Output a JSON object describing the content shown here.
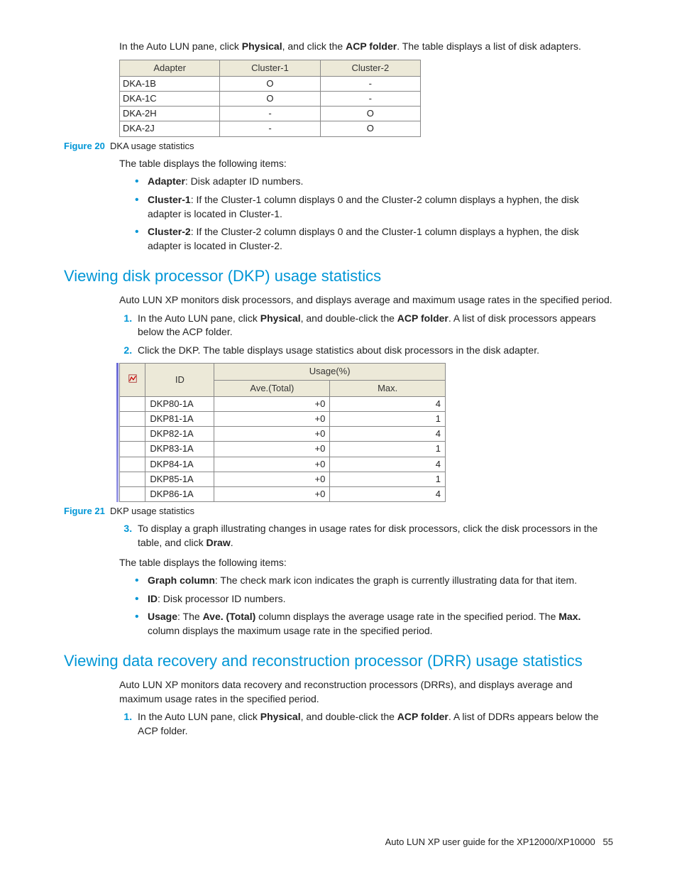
{
  "intro": {
    "p1a": "In the Auto LUN pane, click ",
    "p1b": "Physical",
    "p1c": ", and click the ",
    "p1d": "ACP folder",
    "p1e": ". The table displays a list of disk adapters."
  },
  "dka_table": {
    "headers": [
      "Adapter",
      "Cluster-1",
      "Cluster-2"
    ],
    "rows": [
      [
        "DKA-1B",
        "O",
        "-"
      ],
      [
        "DKA-1C",
        "O",
        "-"
      ],
      [
        "DKA-2H",
        "-",
        "O"
      ],
      [
        "DKA-2J",
        "-",
        "O"
      ]
    ]
  },
  "fig20": {
    "num": "Figure 20",
    "title": "DKA usage statistics"
  },
  "after_fig20": "The table displays the following items:",
  "bullets1": {
    "adapter_b": "Adapter",
    "adapter_t": ": Disk adapter ID numbers.",
    "c1_b": "Cluster-1",
    "c1_t": ": If the Cluster-1 column displays 0 and the Cluster-2 column displays a hyphen, the disk adapter is located in Cluster-1.",
    "c2_b": "Cluster-2",
    "c2_t": ": If the Cluster-2 column displays 0 and the Cluster-1 column displays a hyphen, the disk adapter is located in Cluster-2."
  },
  "h2_dkp": "Viewing disk processor (DKP) usage statistics",
  "dkp_intro": "Auto LUN XP monitors disk processors, and displays average and maximum usage rates in the specified period.",
  "dkp_steps": {
    "s1a": "In the Auto LUN pane, click ",
    "s1b": "Physical",
    "s1c": ", and double-click the ",
    "s1d": "ACP folder",
    "s1e": ". A list of disk processors appears below the ACP folder.",
    "s2": "Click the DKP. The table displays usage statistics about disk processors in the disk adapter.",
    "s3a": "To display a graph illustrating changes in usage rates for disk processors, click the disk processors in the table, and click ",
    "s3b": "Draw",
    "s3c": "."
  },
  "dkp_table": {
    "h_id": "ID",
    "h_usage": "Usage(%)",
    "h_ave": "Ave.(Total)",
    "h_max": "Max.",
    "rows": [
      [
        "DKP80-1A",
        "+0",
        "4"
      ],
      [
        "DKP81-1A",
        "+0",
        "1"
      ],
      [
        "DKP82-1A",
        "+0",
        "4"
      ],
      [
        "DKP83-1A",
        "+0",
        "1"
      ],
      [
        "DKP84-1A",
        "+0",
        "4"
      ],
      [
        "DKP85-1A",
        "+0",
        "1"
      ],
      [
        "DKP86-1A",
        "+0",
        "4"
      ]
    ]
  },
  "fig21": {
    "num": "Figure 21",
    "title": "DKP usage statistics"
  },
  "after_dkp": "The table displays the following items:",
  "bullets2": {
    "g_b": "Graph column",
    "g_t": ": The check mark icon indicates the graph is currently illustrating data for that item.",
    "id_b": "ID",
    "id_t": ": Disk processor ID numbers.",
    "u_b": "Usage",
    "u_t1": ": The ",
    "u_t2": "Ave. (Total)",
    "u_t3": " column displays the average usage rate in the specified period. The ",
    "u_t4": "Max.",
    "u_t5": " column displays the maximum usage rate in the specified period."
  },
  "h2_drr": "Viewing data recovery and reconstruction processor (DRR) usage statistics",
  "drr_intro": "Auto LUN XP monitors data recovery and reconstruction processors (DRRs), and displays average and maximum usage rates in the specified period.",
  "drr_steps": {
    "s1a": "In the Auto LUN pane, click ",
    "s1b": "Physical",
    "s1c": ", and double-click the ",
    "s1d": "ACP folder",
    "s1e": ". A list of DDRs appears below the ACP folder."
  },
  "footer": {
    "text": "Auto LUN XP user guide for the XP12000/XP10000",
    "page": "55"
  }
}
